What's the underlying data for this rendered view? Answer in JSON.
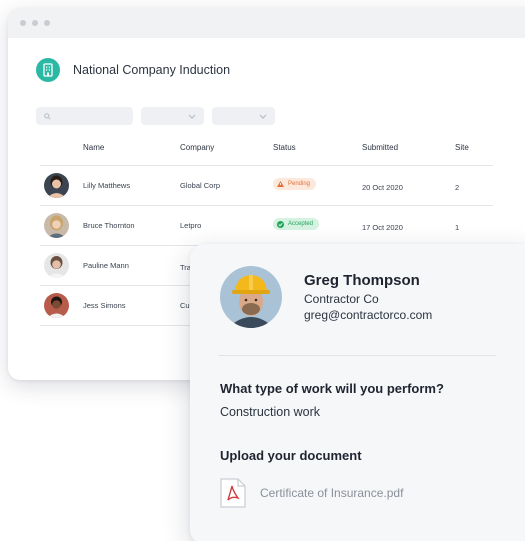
{
  "app": {
    "title": "National Company Induction",
    "logo_icon": "building-icon",
    "accent_color": "#2bb8a4"
  },
  "filters": {
    "search_icon": "search-icon",
    "dropdown_icon": "chevron-down-icon"
  },
  "table": {
    "headers": {
      "name": "Name",
      "company": "Company",
      "status": "Status",
      "submitted": "Submitted",
      "site": "Site"
    },
    "rows": [
      {
        "name": "Lilly Matthews",
        "company": "Global Corp",
        "status": "Pending",
        "status_icon": "warning-icon",
        "status_color": "#e0733c",
        "submitted": "20 Oct 2020",
        "site": "2"
      },
      {
        "name": "Bruce Thornton",
        "company": "Letpro",
        "status": "Accepted",
        "status_icon": "check-circle-icon",
        "status_color": "#22a35a",
        "submitted": "17 Oct 2020",
        "site": "1"
      },
      {
        "name": "Pauline Mann",
        "company": "Tra"
      },
      {
        "name": "Jess Simons",
        "company": "Cui"
      }
    ]
  },
  "profile": {
    "name": "Greg Thompson",
    "company": "Contractor Co",
    "email": "greg@contractorco.com",
    "question": "What type of work will you perform?",
    "answer": "Construction work",
    "upload_title": "Upload your document",
    "file_icon": "pdf-file-icon",
    "file_name": "Certificate of Insurance.pdf"
  }
}
